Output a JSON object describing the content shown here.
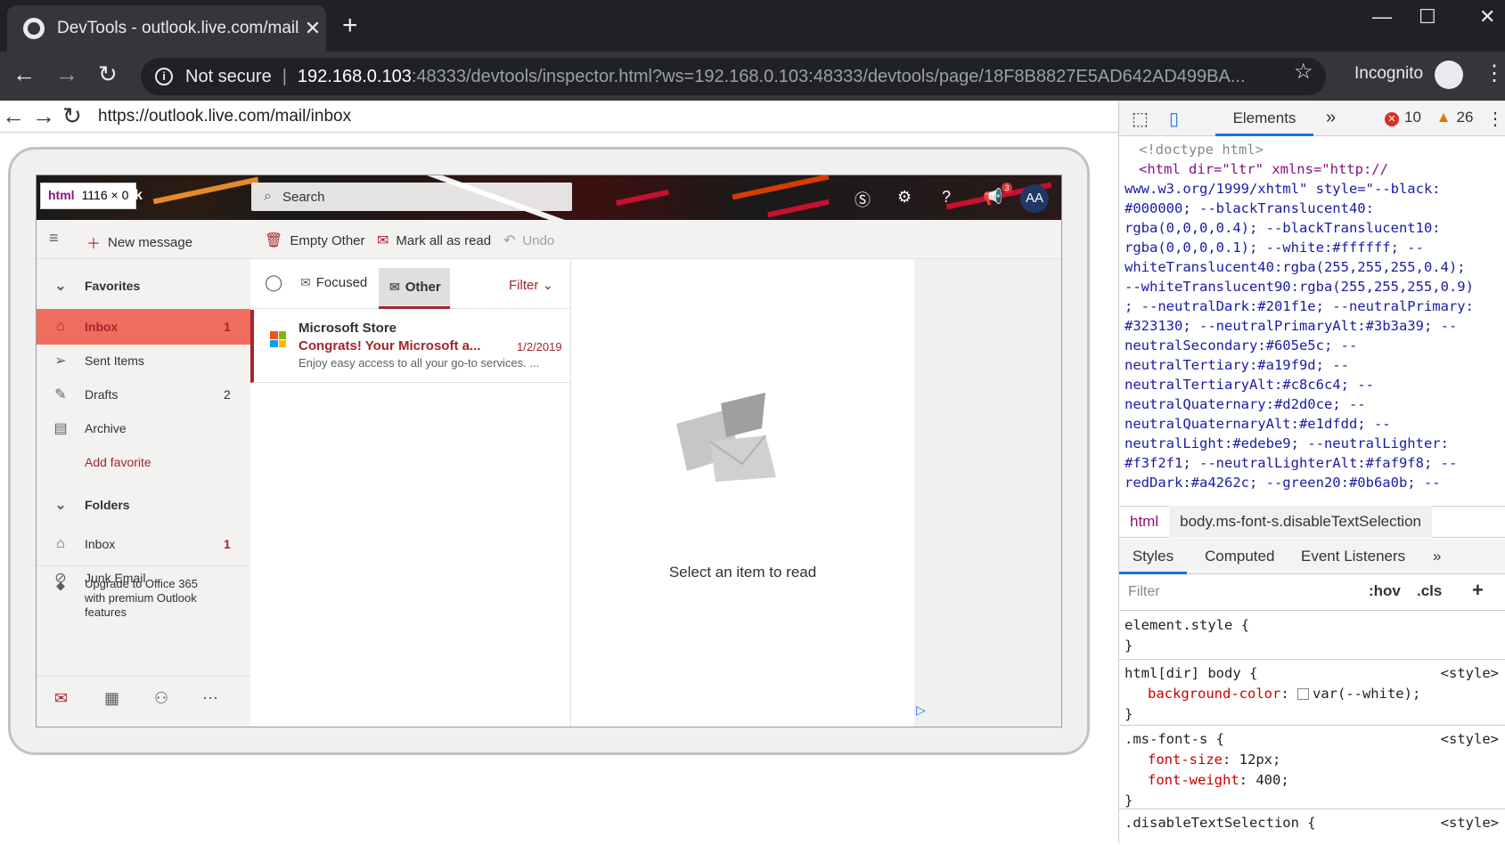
{
  "browser": {
    "tab_title": "DevTools - outlook.live.com/mail/",
    "tab_close": "✕",
    "new_tab": "+",
    "window_controls": [
      "—",
      "☐",
      "✕"
    ],
    "security_label": "Not secure",
    "url_host": "192.168.0.103",
    "url_path": ":48333/devtools/inspector.html?ws=192.168.0.103:48333/devtools/page/18F8B8827E5AD642AD499BA...",
    "incognito_label": "Incognito"
  },
  "page_nav": {
    "url": "https://outlook.live.com/mail/inbox"
  },
  "outlook": {
    "html_badge_tag": "html",
    "html_badge_size": "1116 × 0",
    "html_badge_suffix": "k",
    "search_placeholder": "Search",
    "notification_count": "3",
    "avatar_initials": "AA",
    "commands": {
      "new_message": "New message",
      "empty_other": "Empty Other",
      "mark_all_read": "Mark all as read",
      "undo": "Undo"
    },
    "nav": {
      "favorites": "Favorites",
      "inbox": "Inbox",
      "inbox_count": "1",
      "sent_items": "Sent Items",
      "drafts": "Drafts",
      "drafts_count": "2",
      "archive": "Archive",
      "add_favorite": "Add favorite",
      "folders": "Folders",
      "folders_inbox": "Inbox",
      "folders_inbox_count": "1",
      "junk_email": "Junk Email",
      "upgrade": "Upgrade to Office 365 with premium Outlook features"
    },
    "list": {
      "tab_focused": "Focused",
      "tab_other": "Other",
      "filter": "Filter",
      "mail": {
        "from": "Microsoft Store",
        "subject": "Congrats! Your Microsoft a...",
        "date": "1/2/2019",
        "preview": "Enjoy easy access to all your go-to services. ..."
      }
    },
    "reading_pane": {
      "empty_message": "Select an item to read"
    }
  },
  "devtools": {
    "elements_tab": "Elements",
    "error_count": "10",
    "warning_count": "26",
    "code_lines": [
      "<!doctype html>",
      "<html dir=\"ltr\" xmlns=\"http://",
      "www.w3.org/1999/xhtml\" style=\"--black:",
      "#000000; --blackTranslucent40:",
      "rgba(0,0,0,0.4); --blackTranslucent10:",
      "rgba(0,0,0,0.1); --white:#ffffff; --",
      "whiteTranslucent40:rgba(255,255,255,0.4);",
      "--whiteTranslucent90:rgba(255,255,255,0.9)",
      "; --neutralDark:#201f1e; --neutralPrimary:",
      "#323130; --neutralPrimaryAlt:#3b3a39; --",
      "neutralSecondary:#605e5c; --",
      "neutralTertiary:#a19f9d; --",
      "neutralTertiaryAlt:#c8c6c4; --",
      "neutralQuaternary:#d2d0ce; --",
      "neutralQuaternaryAlt:#e1dfdd; --",
      "neutralLight:#edebe9; --neutralLighter:",
      "#f3f2f1; --neutralLighterAlt:#faf9f8; --",
      "redDark:#a4262c; --green20:#0b6a0b; --"
    ],
    "breadcrumb_html": "html",
    "breadcrumb_body": "body.ms-font-s.disableTextSelection",
    "subtabs": {
      "styles": "Styles",
      "computed": "Computed",
      "event_listeners": "Event Listeners"
    },
    "filter_placeholder": "Filter",
    "hov": ":hov",
    "cls": ".cls",
    "rules": {
      "element_style": "element.style {",
      "close": "}",
      "html_body": "html[dir] body {",
      "style_src": "<style>",
      "bg_prop": "background-color",
      "bg_val": "var(--white);",
      "ms_font": ".ms-font-s {",
      "font_size_prop": "font-size",
      "font_size_val": "12px;",
      "font_weight_prop": "font-weight",
      "font_weight_val": "400;",
      "disable_sel": ".disableTextSelection {"
    }
  }
}
